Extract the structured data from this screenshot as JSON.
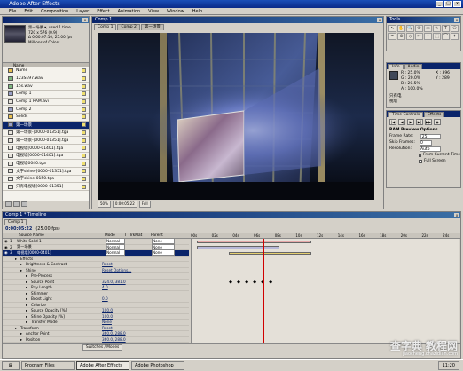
{
  "app": {
    "title": "Adobe After Effects",
    "menu": [
      "File",
      "Edit",
      "Composition",
      "Layer",
      "Effect",
      "Animation",
      "View",
      "Window",
      "Help"
    ]
  },
  "project": {
    "title": "",
    "thumb_info_line1": "第一场景 ▾, used 1 time",
    "thumb_info_line2": "720 x 576 (0.9)",
    "thumb_info_line3": "Δ 0:00:07:10, 25.00 fps",
    "thumb_info_line4": "Millions of Colors",
    "col_name": "Name",
    "items": [
      {
        "name": "Name",
        "type": "",
        "kind": "folder"
      },
      {
        "name": "123SE97.wav",
        "type": "",
        "kind": "audio"
      },
      {
        "name": "15s.wav",
        "type": "",
        "kind": "audio"
      },
      {
        "name": "Comp 1",
        "type": "",
        "kind": "comp"
      },
      {
        "name": "Comp 1 RAM.avi",
        "type": "",
        "kind": "file"
      },
      {
        "name": "Comp 2",
        "type": "",
        "kind": "comp"
      },
      {
        "name": "Solids",
        "type": "",
        "kind": "folder"
      },
      {
        "name": "第一场景",
        "type": "",
        "kind": "comp",
        "selected": true
      },
      {
        "name": "第一场景-[0000-01351].tga",
        "type": "",
        "kind": "file"
      },
      {
        "name": "第一场景-[0000-01351].tga",
        "type": "",
        "kind": "file"
      },
      {
        "name": "电视墙[0000-01401].tga",
        "type": "",
        "kind": "file"
      },
      {
        "name": "电视墙[0000-01401].tga",
        "type": "",
        "kind": "file"
      },
      {
        "name": "电视墙0040.tga",
        "type": "",
        "kind": "file"
      },
      {
        "name": "文字shine-[0000-01351].tga",
        "type": "",
        "kind": "file"
      },
      {
        "name": "文字shine-0150.tga",
        "type": "",
        "kind": "file"
      },
      {
        "name": "只有电视墙[0000-01351]",
        "type": "",
        "kind": "file"
      }
    ]
  },
  "comp_window": {
    "title": "Comp 1",
    "tabs": [
      "Comp 1",
      "Comp 2",
      "第一场景"
    ]
  },
  "tools": {
    "title": "Tools",
    "icons": [
      "↖",
      "✋",
      "🔍",
      "⟳",
      "▭",
      "✎",
      "T",
      "⬠",
      "✒",
      "⊕",
      "◇",
      "✂",
      "⌖",
      "⬚",
      "⌒",
      "✦"
    ]
  },
  "info": {
    "tabs": [
      "Info",
      "Audio"
    ],
    "r": "R : 25.0%",
    "g": "G : 20.0%",
    "b": "B : 20.5%",
    "a": "A : 100.0%",
    "x": "X : 396",
    "y": "Y : 289",
    "text": "只有电",
    "text2": "视墙"
  },
  "time_controls": {
    "tabs": [
      "Time Controls",
      "Effects"
    ],
    "ram_title": "RAM Preview Options",
    "frame_rate_label": "Frame Rate:",
    "frame_rate_value": "(25)",
    "skip_frames_label": "Skip Frames:",
    "skip_frames_value": "0",
    "resolution_label": "Resolution:",
    "resolution_value": "Auto",
    "from_current": "From Current Time",
    "full_screen": "Full Screen"
  },
  "timeline": {
    "title": "Comp 1 * Timeline",
    "tab": "Comp 1",
    "current_time": "0:00:05:22",
    "fps": "(25.00 fps)",
    "headers": [
      "Source Name",
      "Mode",
      "T",
      "TrkMat",
      "Parent"
    ],
    "ruler": [
      "00s",
      "02s",
      "04s",
      "06s",
      "08s",
      "10s",
      "12s",
      "14s",
      "16s",
      "18s",
      "20s",
      "22s",
      "24s"
    ],
    "playhead_fraction": 0.27,
    "layers": [
      {
        "num": "1",
        "name": "White Solid 1",
        "mode": "Normal",
        "parent": "None"
      },
      {
        "num": "2",
        "name": "第一场景",
        "mode": "Normal",
        "parent": "None"
      },
      {
        "num": "3",
        "name": "电视墙[0000-0401]",
        "mode": "Normal",
        "parent": "None",
        "selected": true
      }
    ],
    "props": [
      {
        "indent": 1,
        "name": "Effects",
        "value": ""
      },
      {
        "indent": 2,
        "name": "Brightness & Contrast",
        "value": "Reset"
      },
      {
        "indent": 2,
        "name": "Shine",
        "value": "Reset  Options..."
      },
      {
        "indent": 3,
        "name": "Pre-Process",
        "value": ""
      },
      {
        "indent": 3,
        "name": "Source Point",
        "value": "324.0, 381.0",
        "keyed": true
      },
      {
        "indent": 3,
        "name": "Ray Length",
        "value": "4.0"
      },
      {
        "indent": 3,
        "name": "Shimmer",
        "value": ""
      },
      {
        "indent": 3,
        "name": "Boost Light",
        "value": "0.0"
      },
      {
        "indent": 3,
        "name": "Colorize",
        "value": ""
      },
      {
        "indent": 3,
        "name": "Source Opacity [%]",
        "value": "100.0"
      },
      {
        "indent": 3,
        "name": "Shine Opacity [%]",
        "value": "100.0"
      },
      {
        "indent": 3,
        "name": "Transfer Mode",
        "value": "None"
      },
      {
        "indent": 1,
        "name": "Transform",
        "value": "Reset"
      },
      {
        "indent": 2,
        "name": "Anchor Point",
        "value": "360.0, 288.0"
      },
      {
        "indent": 2,
        "name": "Position",
        "value": "360.0, 288.0"
      },
      {
        "indent": 2,
        "name": "Scale",
        "value": "100.0, 100.0 %"
      },
      {
        "indent": 2,
        "name": "Rotation",
        "value": "0 x +0.0°"
      },
      {
        "indent": 2,
        "name": "Opacity",
        "value": "87 %"
      }
    ],
    "footer": "Switches / Modes"
  },
  "taskbar": {
    "start": "",
    "items": [
      "Program Files",
      "Adobe After Effects",
      "Adobe Photoshop"
    ],
    "clock": "11:20"
  },
  "watermark": {
    "text": "查字典 教程网",
    "sub": "jiaocheng.chazidian.com"
  }
}
